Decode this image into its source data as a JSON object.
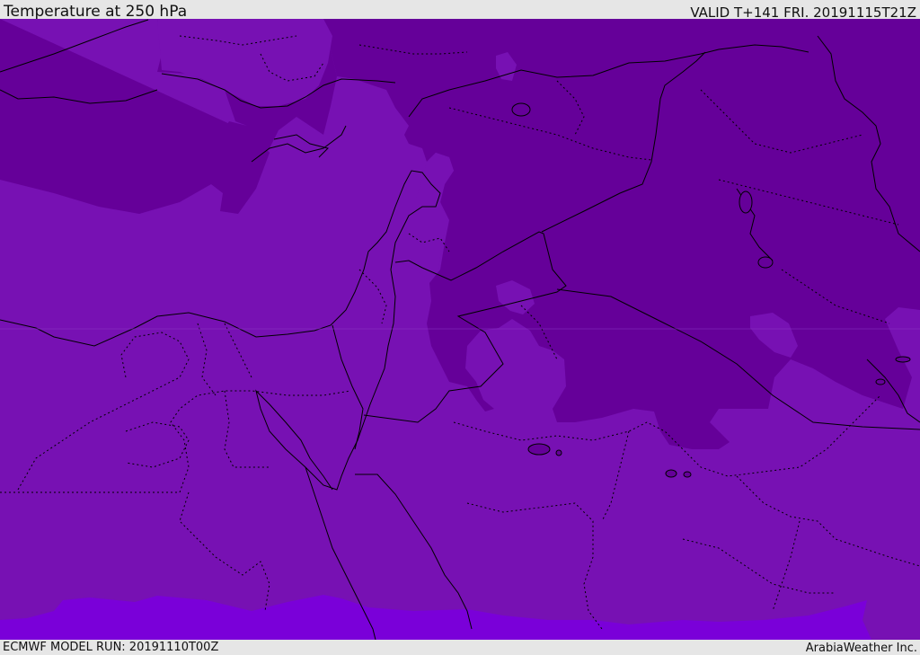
{
  "header": {
    "title": "Temperature at 250 hPa",
    "valid_time": "VALID T+141 FRI. 20191115T21Z"
  },
  "footer": {
    "model_run": "ECMWF MODEL RUN: 20191110T00Z",
    "credit": "ArabiaWeather Inc."
  },
  "colors": {
    "cold_region": "#650099",
    "mid_region": "#7711b3",
    "warm_region": "#7a00d9",
    "borders": "#000000"
  }
}
